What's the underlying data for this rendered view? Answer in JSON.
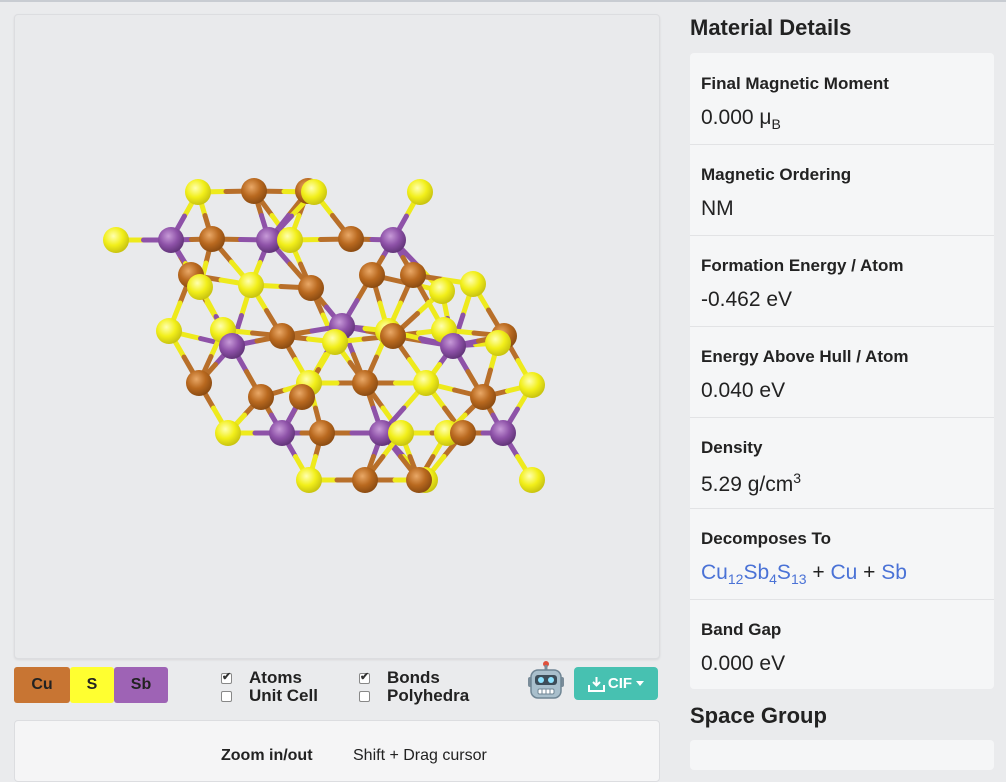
{
  "viewer": {
    "legend": [
      {
        "label": "Cu",
        "color": "#c87533"
      },
      {
        "label": "S",
        "color": "#ffff30"
      },
      {
        "label": "Sb",
        "color": "#9e63b5"
      }
    ],
    "toggles": [
      {
        "label": "Atoms",
        "checked": true
      },
      {
        "label": "Unit Cell",
        "checked": false
      },
      {
        "label": "Bonds",
        "checked": true
      },
      {
        "label": "Polyhedra",
        "checked": false
      }
    ],
    "download_label": "CIF",
    "help": {
      "zoom_label": "Zoom in/out",
      "zoom_hint": "Shift + Drag cursor"
    }
  },
  "details": {
    "title": "Material Details",
    "rows": [
      {
        "label": "Final Magnetic Moment",
        "value": "0.000 μ",
        "sub": "B"
      },
      {
        "label": "Magnetic Ordering",
        "value": "NM"
      },
      {
        "label": "Formation Energy / Atom",
        "value": "-0.462 eV"
      },
      {
        "label": "Energy Above Hull / Atom",
        "value": "0.040 eV"
      },
      {
        "label": "Density",
        "value": "5.29 g/cm",
        "sup": "3"
      },
      {
        "label": "Decomposes To",
        "products": [
          "Cu12Sb4S13",
          "Cu",
          "Sb"
        ]
      },
      {
        "label": "Band Gap",
        "value": "0.000 eV"
      }
    ]
  },
  "space_group": {
    "title": "Space Group"
  },
  "colors": {
    "accent": "#47c1b1",
    "link": "#4a72d6"
  }
}
